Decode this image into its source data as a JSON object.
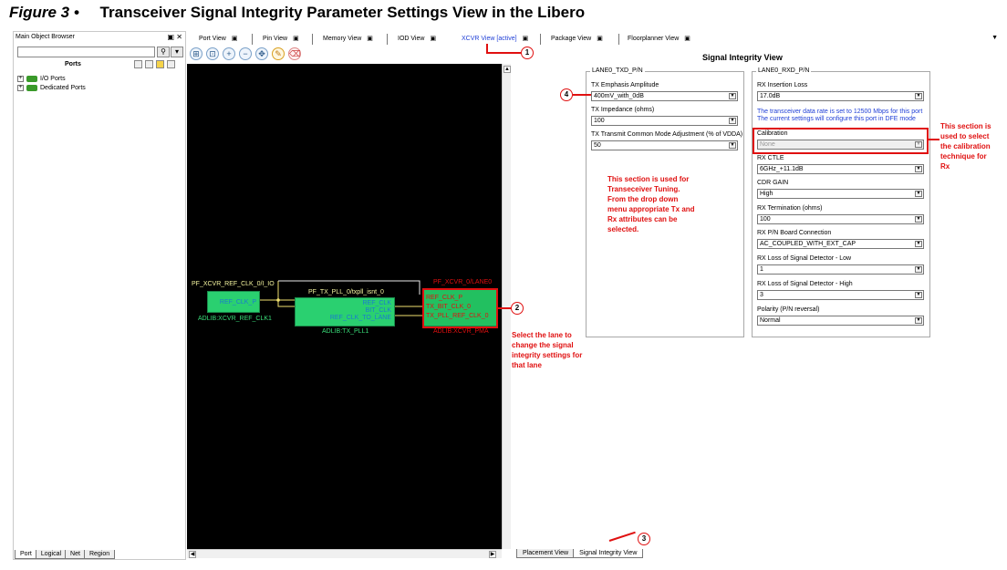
{
  "figure": {
    "number": "Figure 3 •",
    "title": "Transceiver Signal Integrity Parameter Settings View in the Libero"
  },
  "browser": {
    "title": "Main Object Browser",
    "ports_label": "Ports",
    "tree": [
      "I/O Ports",
      "Dedicated Ports"
    ],
    "tabs": [
      "Port",
      "Logical",
      "Net",
      "Region"
    ]
  },
  "tabs": [
    {
      "label": "Port View"
    },
    {
      "label": "Pin View"
    },
    {
      "label": "Memory View"
    },
    {
      "label": "IOD View"
    },
    {
      "label": "XCVR View [active]"
    },
    {
      "label": "Package View"
    },
    {
      "label": "Floorplanner View"
    }
  ],
  "canvas": {
    "ref_clk_title": "PF_XCVR_REF_CLK_0/I_IO",
    "ref_clk_pin": "REF_CLK_P",
    "ref_clk_caption": "ADLIB:XCVR_REF_CLK1",
    "pll_title": "PF_TX_PLL_0/txpll_isnt_0",
    "pll_pins": [
      "REF_CLK",
      "BIT_CLK",
      "REF_CLK_TO_LANE"
    ],
    "pll_caption": "ADLIB:TX_PLL1",
    "lane_title": "PF_XCVR_0/LANE0",
    "lane_pins": [
      "REF_CLK_P",
      "TX_BIT_CLK_0",
      "TX_PLL_REF_CLK_0"
    ],
    "lane_caption": "ADLIB:XCVR_PMA"
  },
  "si": {
    "title": "Signal Integrity View",
    "tx": {
      "group": "LANE0_TXD_P/N",
      "fields": [
        {
          "label": "TX Emphasis Amplitude",
          "value": "400mV_with_0dB"
        },
        {
          "label": "TX Impedance (ohms)",
          "value": "100"
        },
        {
          "label": "TX Transmit Common Mode Adjustment (% of VDDA)",
          "value": "50"
        }
      ]
    },
    "rx": {
      "group": "LANE0_RXD_P/N",
      "insertion_label": "RX Insertion Loss",
      "insertion_value": "17.0dB",
      "info1": "The transceiver data rate is set to 12500 Mbps for this port",
      "info2": "The current settings will configure this port in DFE mode",
      "calibration_label": "Calibration",
      "calibration_value": "None",
      "fields": [
        {
          "label": "RX CTLE",
          "value": "6GHz_+11.1dB"
        },
        {
          "label": "CDR GAIN",
          "value": "High"
        },
        {
          "label": "RX Termination (ohms)",
          "value": "100"
        },
        {
          "label": "RX P/N Board Connection",
          "value": "AC_COUPLED_WITH_EXT_CAP"
        },
        {
          "label": "RX Loss of Signal Detector - Low",
          "value": "1"
        },
        {
          "label": "RX Loss of Signal Detector - High",
          "value": "3"
        },
        {
          "label": "Polarity (P/N reversal)",
          "value": "Normal"
        }
      ]
    },
    "bottom_tabs": [
      "Placement View",
      "Signal Integrity View"
    ]
  },
  "annotations": {
    "markers": [
      "1",
      "2",
      "3",
      "4"
    ],
    "tuning_note": [
      "This section is used for",
      "Transeceiver Tuning.",
      "From the drop down",
      "menu appropriate Tx and",
      "Rx attributes can be",
      "selected."
    ],
    "lane_note": [
      "Select the lane to",
      "change the signal",
      "integrity settings for",
      "that lane"
    ],
    "calib_note": [
      "This section is",
      "used to select",
      "the calibration",
      "technique for",
      "Rx"
    ]
  },
  "colors": {
    "accent_red": "#e01010",
    "active_tab_blue": "#1f3fd6",
    "block_green": "#2ad070",
    "canvas_bg": "#000000"
  }
}
